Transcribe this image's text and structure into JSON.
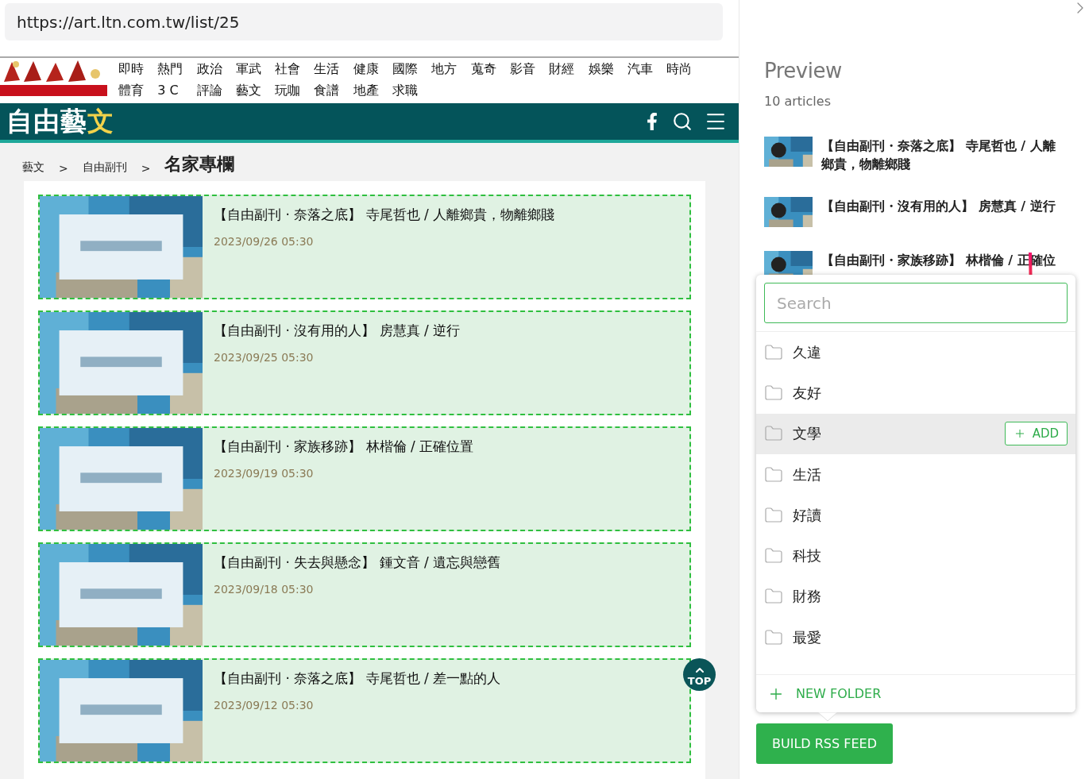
{
  "address_bar": {
    "url": "https://art.ltn.com.tw/list/25"
  },
  "nav": {
    "row_1": [
      "即時",
      "熱門",
      "政治",
      "軍武",
      "社會",
      "生活",
      "健康",
      "國際",
      "地方",
      "蒐奇",
      "影音",
      "財經",
      "娛樂",
      "汽車",
      "時尚"
    ],
    "row_2": [
      "體育",
      "3 C",
      "評論",
      "藝文",
      "玩咖",
      "食譜",
      "地產",
      "求職"
    ]
  },
  "site_header": {
    "logo_parts": [
      "自由藝",
      "文"
    ]
  },
  "breadcrumb": [
    "藝文",
    "自由副刊"
  ],
  "breadcrumb_separator": ">",
  "page_title": "名家專欄",
  "articles": [
    {
      "title": "【自由副刊 · 奈落之底】 寺尾哲也 / 人離鄉貴，物離鄉賤",
      "date": "2023/09/26 05:30"
    },
    {
      "title": "【自由副刊 · 沒有用的人】 房慧真 / 逆行",
      "date": "2023/09/25 05:30"
    },
    {
      "title": "【自由副刊 · 家族移跡】 林楷倫 / 正確位置",
      "date": "2023/09/19 05:30"
    },
    {
      "title": "【自由副刊 · 失去與懸念】 鍾文音 / 遺忘與戀舊",
      "date": "2023/09/18 05:30"
    },
    {
      "title": "【自由副刊 · 奈落之底】 寺尾哲也 / 差一點的人",
      "date": "2023/09/12 05:30"
    }
  ],
  "top_button": {
    "label": "TOP"
  },
  "preview": {
    "title": "Preview",
    "count": "10 articles",
    "items": [
      {
        "title": "【自由副刊・奈落之底】 寺尾哲也 / 人離鄉貴，物離鄉賤"
      },
      {
        "title": "【自由副刊・沒有用的人】 房慧真 / 逆行"
      },
      {
        "title": "【自由副刊・家族移跡】 林楷倫 / 正確位"
      }
    ]
  },
  "folder_menu": {
    "search": {
      "placeholder": "Search"
    },
    "folders": [
      {
        "name": "久違",
        "selected": false
      },
      {
        "name": "友好",
        "selected": false
      },
      {
        "name": "文學",
        "selected": true
      },
      {
        "name": "生活",
        "selected": false
      },
      {
        "name": "好讀",
        "selected": false
      },
      {
        "name": "科技",
        "selected": false
      },
      {
        "name": "財務",
        "selected": false
      },
      {
        "name": "最愛",
        "selected": false
      }
    ],
    "add_button": "ADD",
    "new_folder": "NEW FOLDER"
  },
  "build_button": "BUILD RSS FEED"
}
